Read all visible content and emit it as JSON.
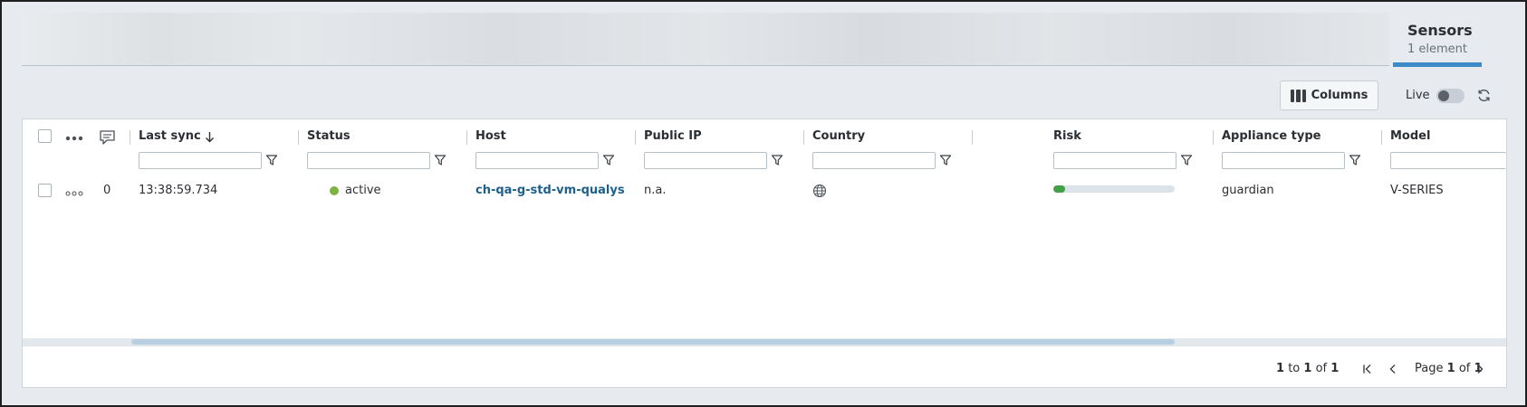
{
  "header": {
    "title": "Sensors",
    "subtitle": "1 element",
    "accent": "#3d8bc6"
  },
  "toolbar": {
    "columns_label": "Columns",
    "live_label": "Live",
    "live_on": false
  },
  "table": {
    "columns": [
      "Last sync",
      "Status",
      "Host",
      "Public IP",
      "Country",
      "Risk",
      "Appliance type",
      "Model"
    ],
    "sort_column": "Last sync",
    "sort_direction": "descending",
    "rows": [
      {
        "comments": "0",
        "last_sync": "13:38:59.734",
        "status": "active",
        "status_color": "#7cb342",
        "host": "ch-qa-g-std-vm-qualys-r",
        "public_ip": "n.a.",
        "country_icon": "globe-icon",
        "risk_fraction": 0.1,
        "appliance_type": "guardian",
        "model": "V-SERIES"
      }
    ]
  },
  "pagination": {
    "from": "1",
    "to_word": "to",
    "to": "1",
    "of_word": "of",
    "total": "1",
    "page_word": "Page",
    "page": "1",
    "pages": "1"
  }
}
